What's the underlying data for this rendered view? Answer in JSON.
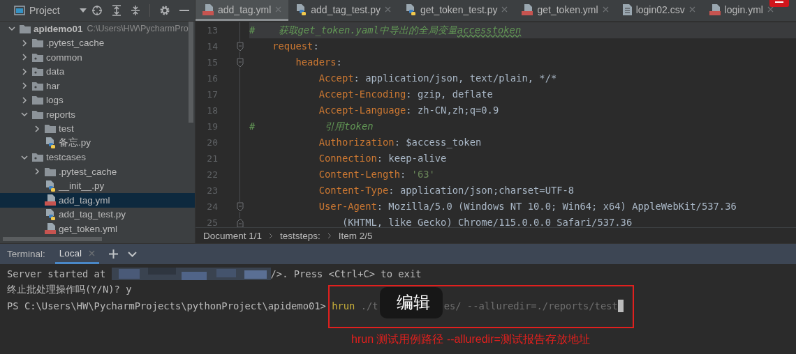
{
  "project_panel": {
    "title": "Project",
    "tree": [
      {
        "label": "apidemo01",
        "path": "C:\\Users\\HW\\PycharmPro",
        "kind": "folder",
        "expanded": true,
        "selected": false,
        "children": [
          {
            "label": ".pytest_cache",
            "kind": "folder",
            "expanded": false,
            "selected": false
          },
          {
            "label": "common",
            "kind": "package",
            "expanded": false,
            "selected": false
          },
          {
            "label": "data",
            "kind": "package",
            "expanded": false,
            "selected": false
          },
          {
            "label": "har",
            "kind": "package",
            "expanded": false,
            "selected": false
          },
          {
            "label": "logs",
            "kind": "folder",
            "expanded": false,
            "selected": false
          },
          {
            "label": "reports",
            "kind": "folder",
            "expanded": true,
            "selected": false,
            "children": [
              {
                "label": "test",
                "kind": "folder",
                "expanded": false,
                "selected": false
              },
              {
                "label": "备忘.py",
                "kind": "python",
                "selected": false
              }
            ]
          },
          {
            "label": "testcases",
            "kind": "package",
            "expanded": true,
            "selected": false,
            "children": [
              {
                "label": ".pytest_cache",
                "kind": "folder",
                "expanded": false,
                "selected": false
              },
              {
                "label": "__init__.py",
                "kind": "python",
                "selected": false
              },
              {
                "label": "add_tag.yml",
                "kind": "yml",
                "selected": true
              },
              {
                "label": "add_tag_test.py",
                "kind": "python",
                "selected": false
              },
              {
                "label": "get_token.yml",
                "kind": "yml",
                "selected": false
              }
            ]
          }
        ]
      }
    ]
  },
  "editor_tabs": [
    {
      "label": "add_tag.yml",
      "kind": "yml",
      "selected": true
    },
    {
      "label": "add_tag_test.py",
      "kind": "python",
      "selected": false
    },
    {
      "label": "get_token_test.py",
      "kind": "python",
      "selected": false
    },
    {
      "label": "get_token.yml",
      "kind": "yml",
      "selected": false
    },
    {
      "label": "login02.csv",
      "kind": "csv",
      "selected": false
    },
    {
      "label": "login.yml",
      "kind": "yml",
      "selected": false
    }
  ],
  "editor": {
    "lines": [
      {
        "number": "13",
        "fold_open": false,
        "fold_close": false,
        "highlighted": true,
        "parts": [
          {
            "kind": "comment",
            "text": "#    获取get_token.yaml中导出的全局变量"
          },
          {
            "kind": "comment-typo",
            "text": "accesstoken"
          }
        ]
      },
      {
        "number": "14",
        "fold_open": true,
        "fold_close": false,
        "highlighted": false,
        "parts": [
          {
            "kind": "key",
            "text": "    request"
          },
          {
            "kind": "plain",
            "text": ":"
          }
        ]
      },
      {
        "number": "15",
        "fold_open": true,
        "fold_close": false,
        "highlighted": false,
        "parts": [
          {
            "kind": "key",
            "text": "        headers"
          },
          {
            "kind": "plain",
            "text": ":"
          }
        ]
      },
      {
        "number": "16",
        "fold_open": false,
        "fold_close": false,
        "highlighted": false,
        "parts": [
          {
            "kind": "key",
            "text": "            Accept"
          },
          {
            "kind": "plain",
            "text": ": application/json, text/plain, */*"
          }
        ]
      },
      {
        "number": "17",
        "fold_open": false,
        "fold_close": false,
        "highlighted": false,
        "parts": [
          {
            "kind": "key",
            "text": "            Accept-Encoding"
          },
          {
            "kind": "plain",
            "text": ": gzip, deflate"
          }
        ]
      },
      {
        "number": "18",
        "fold_open": false,
        "fold_close": false,
        "highlighted": false,
        "parts": [
          {
            "kind": "key",
            "text": "            Accept-Language"
          },
          {
            "kind": "plain",
            "text": ": zh-CN,zh;q=0.9"
          }
        ]
      },
      {
        "number": "19",
        "fold_open": false,
        "fold_close": false,
        "highlighted": false,
        "parts": [
          {
            "kind": "comment",
            "text": "#            引用token"
          }
        ]
      },
      {
        "number": "20",
        "fold_open": false,
        "fold_close": false,
        "highlighted": false,
        "parts": [
          {
            "kind": "key",
            "text": "            Authorization"
          },
          {
            "kind": "plain",
            "text": ": $access_token"
          }
        ]
      },
      {
        "number": "21",
        "fold_open": false,
        "fold_close": false,
        "highlighted": false,
        "parts": [
          {
            "kind": "key",
            "text": "            Connection"
          },
          {
            "kind": "plain",
            "text": ": keep-alive"
          }
        ]
      },
      {
        "number": "22",
        "fold_open": false,
        "fold_close": false,
        "highlighted": false,
        "parts": [
          {
            "kind": "key",
            "text": "            Content-Length"
          },
          {
            "kind": "plain",
            "text": ": "
          },
          {
            "kind": "string",
            "text": "'63'"
          }
        ]
      },
      {
        "number": "23",
        "fold_open": false,
        "fold_close": false,
        "highlighted": false,
        "parts": [
          {
            "kind": "key",
            "text": "            Content-Type"
          },
          {
            "kind": "plain",
            "text": ": application/json;charset=UTF-8"
          }
        ]
      },
      {
        "number": "24",
        "fold_open": true,
        "fold_close": false,
        "highlighted": false,
        "parts": [
          {
            "kind": "key",
            "text": "            User-Agent"
          },
          {
            "kind": "plain",
            "text": ": Mozilla/5.0 (Windows NT 10.0; Win64; x64) AppleWebKit/537.36"
          }
        ]
      },
      {
        "number": "25",
        "fold_open": false,
        "fold_close": true,
        "highlighted": false,
        "parts": [
          {
            "kind": "plain",
            "text": "                (KHTML, like Gecko) Chrome/115.0.0.0 Safari/537.36"
          }
        ]
      }
    ]
  },
  "breadcrumb": [
    "Document 1/1",
    "teststeps:",
    "Item 2/5"
  ],
  "terminal": {
    "label": "Terminal:",
    "tabs": [
      {
        "label": "Local",
        "selected": true
      }
    ],
    "lines": [
      {
        "parts": [
          {
            "kind": "text",
            "text": "Server started at "
          },
          {
            "kind": "redacted"
          },
          {
            "kind": "text",
            "text": "/>. Press <Ctrl+C> to exit"
          }
        ]
      },
      {
        "parts": [
          {
            "kind": "text",
            "text": "终止批处理操作吗(Y/N)? y"
          }
        ]
      },
      {
        "parts": [
          {
            "kind": "text",
            "text": "PS C:\\Users\\HW\\PycharmProjects\\pythonProject\\apidemo01> "
          },
          {
            "kind": "command",
            "text": "hrun"
          },
          {
            "kind": "hint",
            "text": " ./t"
          },
          {
            "kind": "tooltip",
            "text": "编辑"
          },
          {
            "kind": "hint",
            "text": "es/ --alluredir=./reports/test"
          },
          {
            "kind": "cursor"
          }
        ]
      }
    ]
  },
  "annotation": {
    "note": "hrun  测试用例路径 --alluredir=测试报告存放地址"
  }
}
